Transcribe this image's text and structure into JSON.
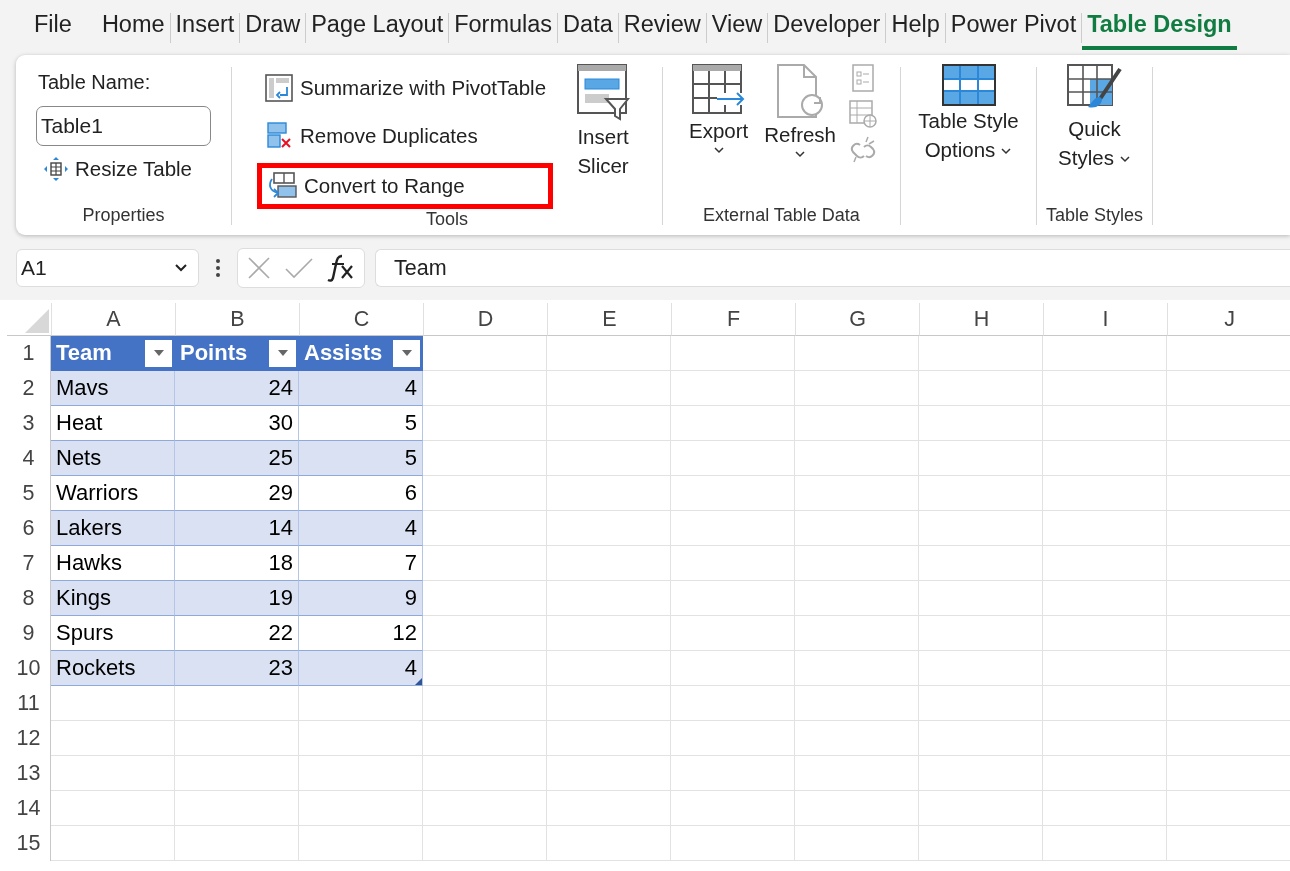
{
  "tabs": [
    {
      "label": "File",
      "selected": false
    },
    {
      "label": "Home",
      "selected": false
    },
    {
      "label": "Insert",
      "selected": false
    },
    {
      "label": "Draw",
      "selected": false
    },
    {
      "label": "Page Layout",
      "selected": false
    },
    {
      "label": "Formulas",
      "selected": false
    },
    {
      "label": "Data",
      "selected": false
    },
    {
      "label": "Review",
      "selected": false
    },
    {
      "label": "View",
      "selected": false
    },
    {
      "label": "Developer",
      "selected": false
    },
    {
      "label": "Help",
      "selected": false
    },
    {
      "label": "Power Pivot",
      "selected": false
    },
    {
      "label": "Table Design",
      "selected": true
    }
  ],
  "ribbon": {
    "properties": {
      "name_label": "Table Name:",
      "table_name": "Table1",
      "resize": "Resize Table",
      "label": "Properties"
    },
    "tools": {
      "summarize": "Summarize with PivotTable",
      "remove_duplicates": "Remove Duplicates",
      "convert": {
        "label": "Convert to Range",
        "highlighted": true
      },
      "insert_slicer": "Insert Slicer",
      "label": "Tools"
    },
    "external": {
      "export": "Export",
      "refresh": "Refresh",
      "label": "External Table Data"
    },
    "style_options": {
      "button": "Table Style Options"
    },
    "styles": {
      "quick": "Quick Styles",
      "label": "Table Styles"
    }
  },
  "formula_bar": {
    "name_box": "A1",
    "value": "Team"
  },
  "sheet": {
    "columns": [
      "A",
      "B",
      "C",
      "D",
      "E",
      "F",
      "G",
      "H",
      "I",
      "J"
    ],
    "row_numbers": [
      "1",
      "2",
      "3",
      "4",
      "5",
      "6",
      "7",
      "8",
      "9",
      "10",
      "11",
      "12",
      "13",
      "14",
      "15"
    ],
    "table": {
      "headers": [
        "Team",
        "Points",
        "Assists"
      ],
      "rows": [
        [
          "Mavs",
          "24",
          "4"
        ],
        [
          "Heat",
          "30",
          "5"
        ],
        [
          "Nets",
          "25",
          "5"
        ],
        [
          "Warriors",
          "29",
          "6"
        ],
        [
          "Lakers",
          "14",
          "4"
        ],
        [
          "Hawks",
          "18",
          "7"
        ],
        [
          "Kings",
          "19",
          "9"
        ],
        [
          "Spurs",
          "22",
          "12"
        ],
        [
          "Rockets",
          "23",
          "4"
        ]
      ]
    }
  }
}
